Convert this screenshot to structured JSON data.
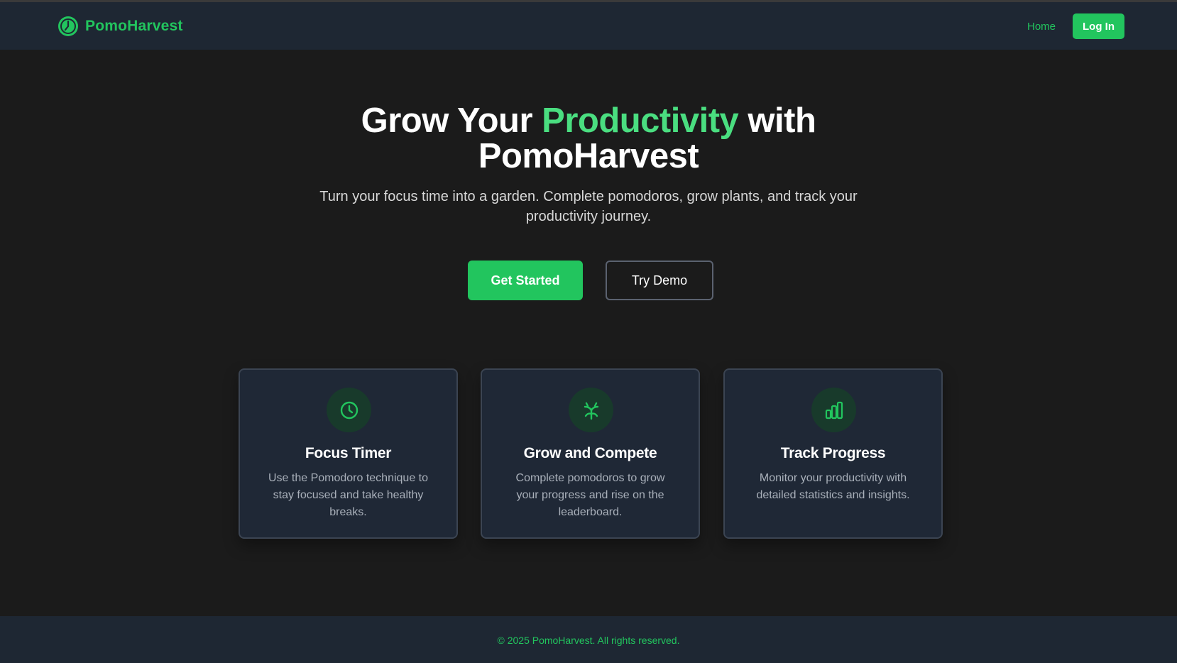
{
  "colors": {
    "accent": "#22c55e",
    "accent_light": "#4ade80",
    "background": "#1b1b1b",
    "surface": "#1e2733"
  },
  "header": {
    "brand_name": "PomoHarvest",
    "brand_icon": "clock-logo-icon",
    "nav_home": "Home",
    "login_label": "Log In"
  },
  "hero": {
    "title_part1": "Grow Your ",
    "title_accent": "Productivity",
    "title_part2": " with",
    "title_line2": "PomoHarvest",
    "subtitle": "Turn your focus time into a garden. Complete pomodoros, grow plants, and track your productivity journey.",
    "primary_cta": "Get Started",
    "secondary_cta": "Try Demo"
  },
  "features": [
    {
      "icon": "clock-icon",
      "title": "Focus Timer",
      "description": "Use the Pomodoro technique to stay focused and take healthy breaks."
    },
    {
      "icon": "sprout-icon",
      "title": "Grow and Compete",
      "description": "Complete pomodoros to grow your progress and rise on the leaderboard."
    },
    {
      "icon": "bar-chart-icon",
      "title": "Track Progress",
      "description": "Monitor your productivity with detailed statistics and insights."
    }
  ],
  "footer": {
    "copyright": "© 2025 PomoHarvest. All rights reserved."
  }
}
